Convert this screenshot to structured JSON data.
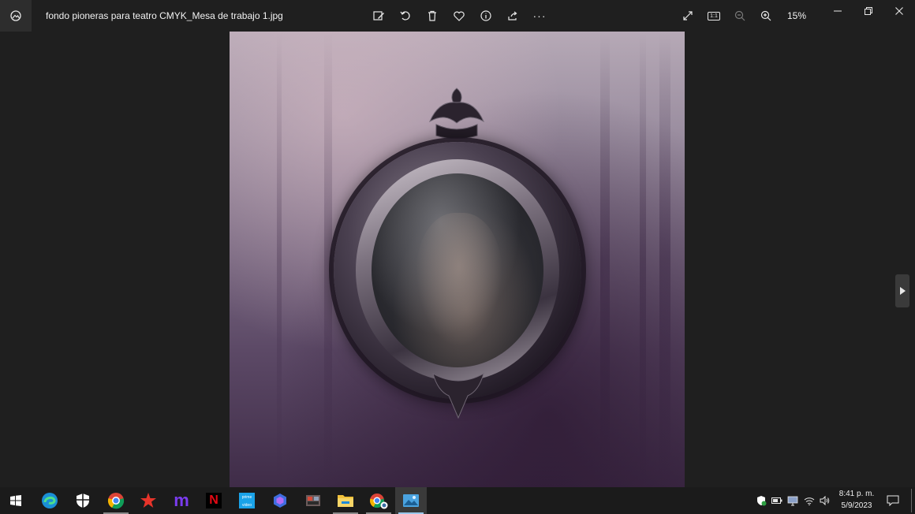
{
  "titlebar": {
    "file_name": "fondo pioneras para teatro CMYK_Mesa de trabajo 1.jpg",
    "zoom": "15%",
    "toolbar_icons": [
      "edit-image-icon",
      "rotate-icon",
      "delete-icon",
      "favorite-icon",
      "info-icon",
      "share-icon",
      "more-icon"
    ],
    "view_icons": [
      "fullscreen-icon",
      "actual-size-icon",
      "zoom-out-icon",
      "zoom-in-icon"
    ],
    "actual_size_label": "1:1",
    "more_label": "···"
  },
  "window_controls": [
    "minimize-icon",
    "restore-icon",
    "close-icon"
  ],
  "taskbar": {
    "apps": [
      "start-icon",
      "edge-icon",
      "security-icon",
      "chrome-icon",
      "star-app-icon",
      "m-app-icon",
      "netflix-icon",
      "prime-video-icon",
      "copilot-icon",
      "media-app-icon",
      "file-explorer-icon",
      "chrome-profile-icon",
      "photos-icon"
    ],
    "netflix_label": "N",
    "prime_label": "prime video",
    "m_label": "m",
    "clock_time": "8:41 p. m.",
    "clock_date": "5/9/2023"
  },
  "colors": {
    "background": "#1f1f1f",
    "taskbar": "#1b1b1b",
    "accent": "#9cc7ea"
  }
}
